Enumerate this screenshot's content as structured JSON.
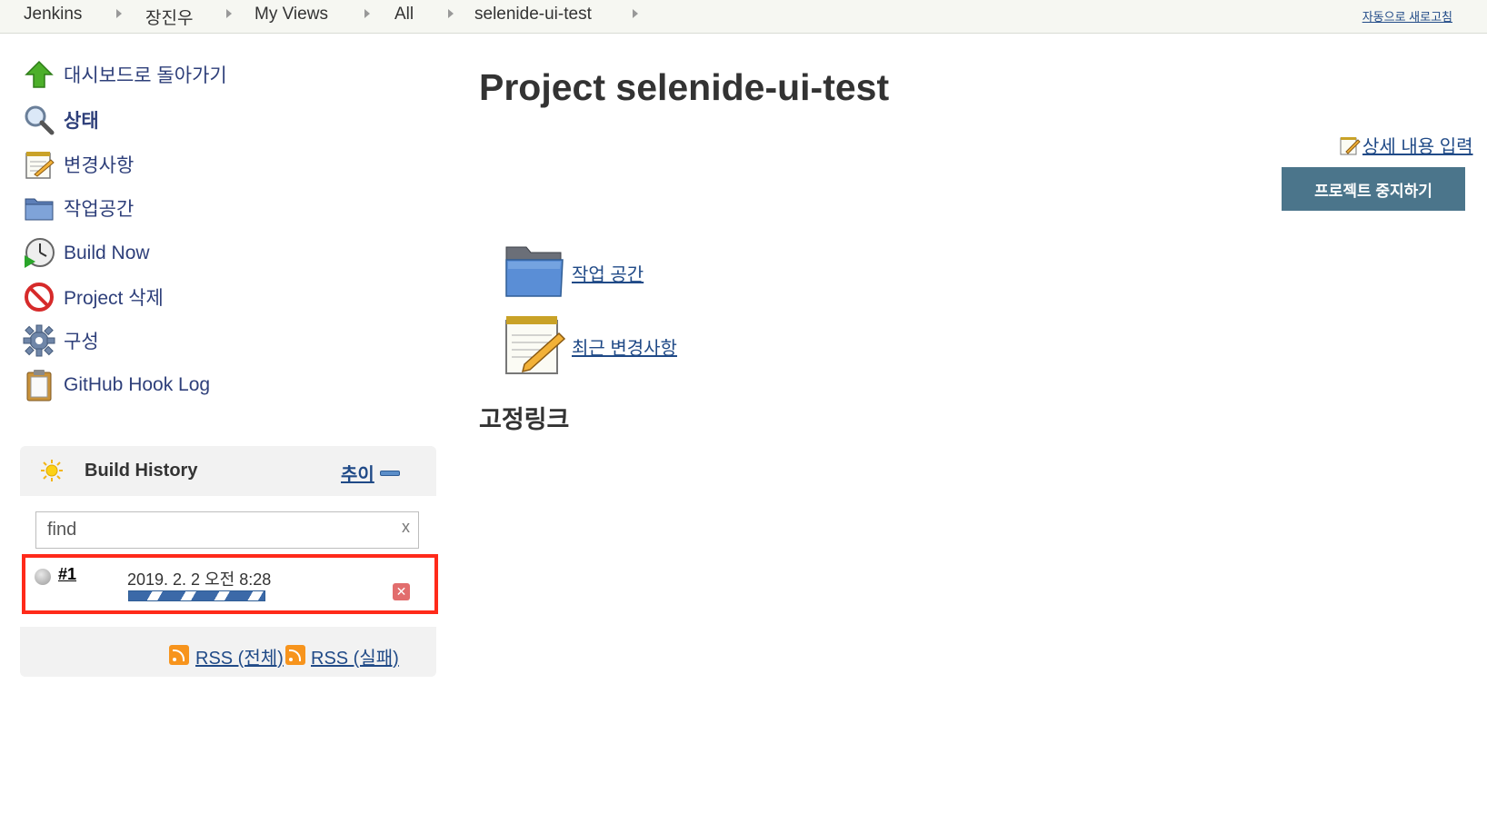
{
  "breadcrumb": {
    "items": [
      "Jenkins",
      "장진우",
      "My Views",
      "All",
      "selenide-ui-test"
    ],
    "auto_refresh": "자동으로 새로고침"
  },
  "sidebar": {
    "tasks": [
      {
        "label": "대시보드로 돌아가기",
        "icon": "up-arrow-icon"
      },
      {
        "label": "상태",
        "icon": "magnifier-icon"
      },
      {
        "label": "변경사항",
        "icon": "notepad-icon"
      },
      {
        "label": "작업공간",
        "icon": "folder-icon"
      },
      {
        "label": "Build Now",
        "icon": "clock-icon"
      },
      {
        "label": "Project 삭제",
        "icon": "no-entry-icon"
      },
      {
        "label": "구성",
        "icon": "gear-icon"
      },
      {
        "label": "GitHub Hook Log",
        "icon": "clipboard-icon"
      }
    ]
  },
  "build_history": {
    "title": "Build History",
    "trend": "추이",
    "search": {
      "value": "find",
      "clear": "x"
    },
    "builds": [
      {
        "number": "#1",
        "date": "2019. 2. 2 오전 8:28",
        "status": "in-progress"
      }
    ],
    "rss_all": "RSS (전체)",
    "rss_failed": "RSS (실패)"
  },
  "main": {
    "title": "Project selenide-ui-test",
    "edit_description": "상세 내용 입력",
    "disable_button": "프로젝트 중지하기",
    "links": [
      {
        "label": "작업 공간",
        "icon": "folder-icon"
      },
      {
        "label": "최근 변경사항",
        "icon": "notepad-icon"
      }
    ],
    "permalinks_title": "고정링크"
  },
  "colors": {
    "link": "#204a87",
    "button_bg": "#4b758b",
    "highlight": "#ff2a1a"
  }
}
